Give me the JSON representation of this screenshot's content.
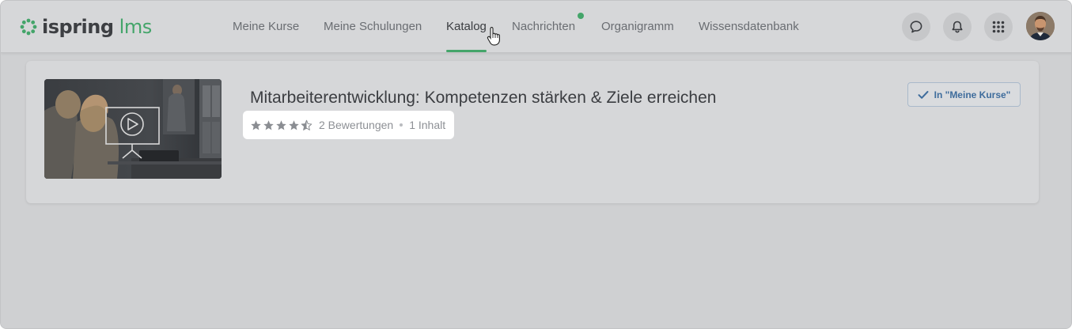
{
  "header": {
    "logo": {
      "brand": "ispring",
      "product": "lms"
    },
    "nav": [
      {
        "label": "Meine Kurse"
      },
      {
        "label": "Meine Schulungen"
      },
      {
        "label": "Katalog",
        "active": true
      },
      {
        "label": "Nachrichten",
        "has_notification_dot": true
      },
      {
        "label": "Organigramm"
      },
      {
        "label": "Wissensdatenbank"
      }
    ],
    "icons": [
      "chat-icon",
      "bell-icon",
      "apps-grid-icon"
    ],
    "accent_color": "#44a56a"
  },
  "course": {
    "title": "Mitarbeiterentwicklung: Kompetenzen stärken & Ziele erreichen",
    "rating": 4.5,
    "ratings_text": "2 Bewertungen",
    "content_text": "1 Inhalt",
    "button_label": "In \"Meine Kurse\""
  }
}
